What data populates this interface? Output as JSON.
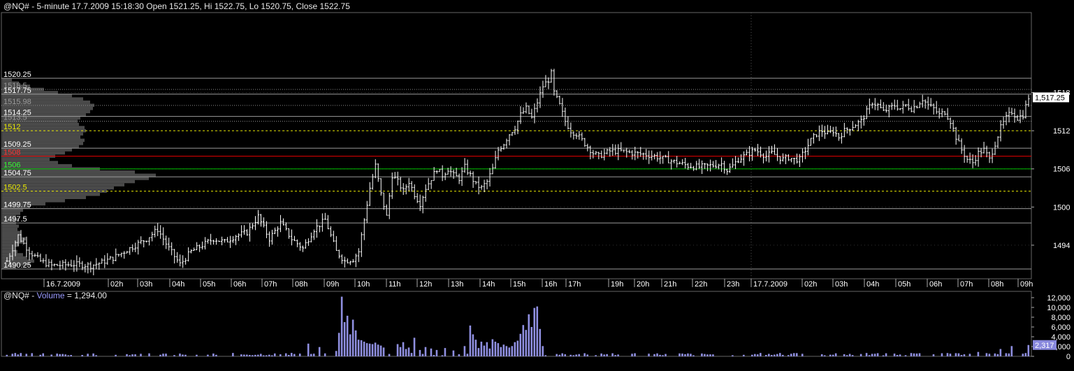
{
  "header": {
    "title": "@NQ# - 5-minute 17.7.2009 15:18:30 Open 1521.25, Hi 1522.75, Lo 1520.75, Close 1522.75"
  },
  "volume_header": {
    "prefix": "@NQ# - ",
    "label": "Volume",
    "value_text": " = 1,294.00"
  },
  "colors": {
    "background": "#000000",
    "bars": "#ffffff",
    "volume": "#8f8fe0",
    "level_red": "#e00000",
    "level_green": "#00c000",
    "level_yellow": "#e8e800",
    "level_gray": "#8c8c8c"
  },
  "chart_data": [
    {
      "type": "bar",
      "name": "price",
      "y_axis_ticks": [
        1494,
        1500,
        1506,
        1512,
        1518
      ],
      "ylim": [
        1489,
        1524
      ],
      "current_price": "1,517.25",
      "x_tick_labels": [
        "16.7.2009",
        "02h",
        "03h",
        "04h",
        "05h",
        "06h",
        "07h",
        "08h",
        "09h",
        "10h",
        "11h",
        "12h",
        "13h",
        "14h",
        "15h",
        "16h",
        "17h",
        "19h",
        "20h",
        "21h",
        "22h",
        "23h",
        "17.7.2009",
        "02h",
        "03h",
        "04h",
        "05h",
        "06h",
        "07h",
        "08h",
        "09h"
      ],
      "level_lines": [
        {
          "label": "1520.25",
          "value": 1520.25,
          "style": "solid",
          "color": "gray"
        },
        {
          "label": "1518.5",
          "value": 1518.5,
          "style": "dotted",
          "color": "gray"
        },
        {
          "label": "1517.75",
          "value": 1517.75,
          "style": "solid",
          "color": "gray"
        },
        {
          "label": "1515.98",
          "value": 1515.98,
          "style": "dotted",
          "color": "gray"
        },
        {
          "label": "1514.25",
          "value": 1514.25,
          "style": "solid",
          "color": "gray"
        },
        {
          "label": "1513.5",
          "value": 1513.5,
          "style": "dotted",
          "color": "gray"
        },
        {
          "label": "1512",
          "value": 1512,
          "style": "dashed",
          "color": "yellow"
        },
        {
          "label": "1509.25",
          "value": 1509.25,
          "style": "solid",
          "color": "gray"
        },
        {
          "label": "1508",
          "value": 1508,
          "style": "solid",
          "color": "red"
        },
        {
          "label": "1506",
          "value": 1506,
          "style": "solid",
          "color": "green"
        },
        {
          "label": "1504.75",
          "value": 1504.75,
          "style": "solid",
          "color": "gray"
        },
        {
          "label": "1502.5",
          "value": 1502.5,
          "style": "dashed",
          "color": "yellow"
        },
        {
          "label": "1499.75",
          "value": 1499.75,
          "style": "solid",
          "color": "gray"
        },
        {
          "label": "1497.5",
          "value": 1497.5,
          "style": "solid",
          "color": "gray"
        },
        {
          "label": "1490.25",
          "value": 1490.25,
          "style": "solid",
          "color": "gray"
        }
      ],
      "close_path": [
        [
          0,
          1491.5
        ],
        [
          4,
          1495.5
        ],
        [
          8,
          1493
        ],
        [
          12,
          1491.5
        ],
        [
          16,
          1490.8
        ],
        [
          24,
          1491
        ],
        [
          30,
          1490.8
        ],
        [
          34,
          1491.3
        ],
        [
          38,
          1492
        ],
        [
          42,
          1493
        ],
        [
          46,
          1494
        ],
        [
          50,
          1495
        ],
        [
          54,
          1496.5
        ],
        [
          58,
          1493.5
        ],
        [
          62,
          1491
        ],
        [
          66,
          1493
        ],
        [
          70,
          1494
        ],
        [
          74,
          1495
        ],
        [
          78,
          1494.5
        ],
        [
          82,
          1495.5
        ],
        [
          86,
          1496
        ],
        [
          90,
          1498.5
        ],
        [
          94,
          1495
        ],
        [
          98,
          1497.5
        ],
        [
          102,
          1495
        ],
        [
          106,
          1493.5
        ],
        [
          110,
          1496.5
        ],
        [
          114,
          1498
        ],
        [
          118,
          1493
        ],
        [
          121,
          1491.5
        ],
        [
          124,
          1491.8
        ],
        [
          126,
          1493
        ],
        [
          128,
          1498
        ],
        [
          130,
          1503
        ],
        [
          132,
          1506.5
        ],
        [
          134,
          1502
        ],
        [
          136,
          1498.5
        ],
        [
          138,
          1505
        ],
        [
          140,
          1504
        ],
        [
          142,
          1502.5
        ],
        [
          144,
          1504
        ],
        [
          146,
          1502
        ],
        [
          148,
          1500.5
        ],
        [
          150,
          1503
        ],
        [
          152,
          1504.5
        ],
        [
          154,
          1506
        ],
        [
          156,
          1505
        ],
        [
          158,
          1506
        ],
        [
          160,
          1505
        ],
        [
          162,
          1504.5
        ],
        [
          164,
          1506.3
        ],
        [
          166,
          1505
        ],
        [
          168,
          1503.5
        ],
        [
          170,
          1503
        ],
        [
          172,
          1504
        ],
        [
          174,
          1506
        ],
        [
          176,
          1509
        ],
        [
          178,
          1510
        ],
        [
          180,
          1511.5
        ],
        [
          182,
          1512.5
        ],
        [
          184,
          1514.5
        ],
        [
          186,
          1515.5
        ],
        [
          188,
          1514
        ],
        [
          190,
          1516.5
        ],
        [
          192,
          1519
        ],
        [
          194,
          1520
        ],
        [
          195,
          1521
        ],
        [
          196,
          1518
        ],
        [
          198,
          1516
        ],
        [
          200,
          1513.5
        ],
        [
          202,
          1512
        ],
        [
          204,
          1511.5
        ],
        [
          206,
          1510.5
        ],
        [
          208,
          1509.5
        ],
        [
          210,
          1508.5
        ],
        [
          212,
          1508
        ],
        [
          216,
          1508.8
        ],
        [
          220,
          1508.8
        ],
        [
          224,
          1508.5
        ],
        [
          228,
          1508.3
        ],
        [
          232,
          1508
        ],
        [
          236,
          1507.5
        ],
        [
          240,
          1507
        ],
        [
          244,
          1506.5
        ],
        [
          248,
          1506.3
        ],
        [
          252,
          1506.5
        ],
        [
          256,
          1506.8
        ],
        [
          258,
          1505.8
        ],
        [
          260,
          1506.5
        ],
        [
          262,
          1507.5
        ],
        [
          264,
          1508
        ],
        [
          266,
          1508.5
        ],
        [
          268,
          1509
        ],
        [
          270,
          1508.5
        ],
        [
          272,
          1508
        ],
        [
          274,
          1508.5
        ],
        [
          276,
          1508
        ],
        [
          278,
          1507.5
        ],
        [
          280,
          1507.8
        ],
        [
          282,
          1507.5
        ],
        [
          284,
          1507.5
        ],
        [
          286,
          1509
        ],
        [
          288,
          1510.5
        ],
        [
          290,
          1511.5
        ],
        [
          292,
          1512
        ],
        [
          294,
          1511.5
        ],
        [
          296,
          1512
        ],
        [
          298,
          1511
        ],
        [
          300,
          1512
        ],
        [
          302,
          1512.5
        ],
        [
          304,
          1513
        ],
        [
          306,
          1513.5
        ],
        [
          308,
          1515
        ],
        [
          310,
          1516.5
        ],
        [
          312,
          1516
        ],
        [
          314,
          1515
        ],
        [
          316,
          1515.5
        ],
        [
          318,
          1516
        ],
        [
          320,
          1515.5
        ],
        [
          322,
          1516
        ],
        [
          324,
          1515.5
        ],
        [
          326,
          1516
        ],
        [
          328,
          1517
        ],
        [
          330,
          1516
        ],
        [
          332,
          1515.5
        ],
        [
          334,
          1514.5
        ],
        [
          336,
          1515
        ],
        [
          338,
          1513.5
        ],
        [
          340,
          1511
        ],
        [
          342,
          1509
        ],
        [
          344,
          1507.5
        ],
        [
          346,
          1507
        ],
        [
          348,
          1508.5
        ],
        [
          350,
          1509
        ],
        [
          352,
          1507.5
        ],
        [
          354,
          1510
        ],
        [
          356,
          1512.5
        ],
        [
          358,
          1514
        ],
        [
          360,
          1515
        ],
        [
          362,
          1514
        ],
        [
          364,
          1514.5
        ],
        [
          366,
          1517.25
        ]
      ]
    },
    {
      "type": "bar",
      "name": "volume",
      "y_axis_ticks": [
        0,
        2000,
        4000,
        6000,
        8000,
        10000,
        12000
      ],
      "y_axis_labels": [
        "0",
        "2,000",
        "4,000",
        "6,000",
        "8,000",
        "10,000",
        "12,000"
      ],
      "ylim": [
        0,
        13000
      ],
      "current_volume": "2,317",
      "spikes": [
        [
          108,
          2600
        ],
        [
          112,
          1900
        ],
        [
          118,
          1100
        ],
        [
          119,
          4800
        ],
        [
          120,
          12200
        ],
        [
          121,
          7000
        ],
        [
          122,
          8300
        ],
        [
          123,
          4500
        ],
        [
          124,
          7500
        ],
        [
          125,
          5300
        ],
        [
          126,
          3400
        ],
        [
          127,
          3300
        ],
        [
          128,
          3000
        ],
        [
          129,
          2700
        ],
        [
          130,
          2600
        ],
        [
          131,
          2500
        ],
        [
          132,
          2800
        ],
        [
          133,
          2400
        ],
        [
          134,
          2200
        ],
        [
          135,
          1800
        ],
        [
          140,
          2500
        ],
        [
          141,
          1900
        ],
        [
          142,
          2900
        ],
        [
          143,
          1500
        ],
        [
          144,
          1800
        ],
        [
          146,
          3800
        ],
        [
          148,
          1300
        ],
        [
          150,
          1900
        ],
        [
          152,
          1600
        ],
        [
          154,
          1300
        ],
        [
          157,
          1700
        ],
        [
          160,
          1200
        ],
        [
          164,
          2100
        ],
        [
          166,
          6300
        ],
        [
          167,
          4500
        ],
        [
          168,
          3400
        ],
        [
          169,
          1700
        ],
        [
          170,
          3000
        ],
        [
          171,
          2200
        ],
        [
          172,
          2900
        ],
        [
          173,
          1600
        ],
        [
          174,
          3500
        ],
        [
          175,
          3000
        ],
        [
          176,
          2700
        ],
        [
          177,
          1900
        ],
        [
          178,
          2400
        ],
        [
          179,
          2100
        ],
        [
          180,
          1800
        ],
        [
          181,
          2100
        ],
        [
          182,
          2900
        ],
        [
          183,
          3200
        ],
        [
          184,
          4600
        ],
        [
          185,
          6400
        ],
        [
          186,
          5400
        ],
        [
          187,
          8600
        ],
        [
          188,
          6000
        ],
        [
          189,
          9900
        ],
        [
          190,
          10200
        ],
        [
          191,
          5600
        ],
        [
          192,
          2100
        ],
        [
          348,
          900
        ],
        [
          356,
          1500
        ],
        [
          360,
          2100
        ],
        [
          366,
          2317
        ]
      ]
    }
  ]
}
